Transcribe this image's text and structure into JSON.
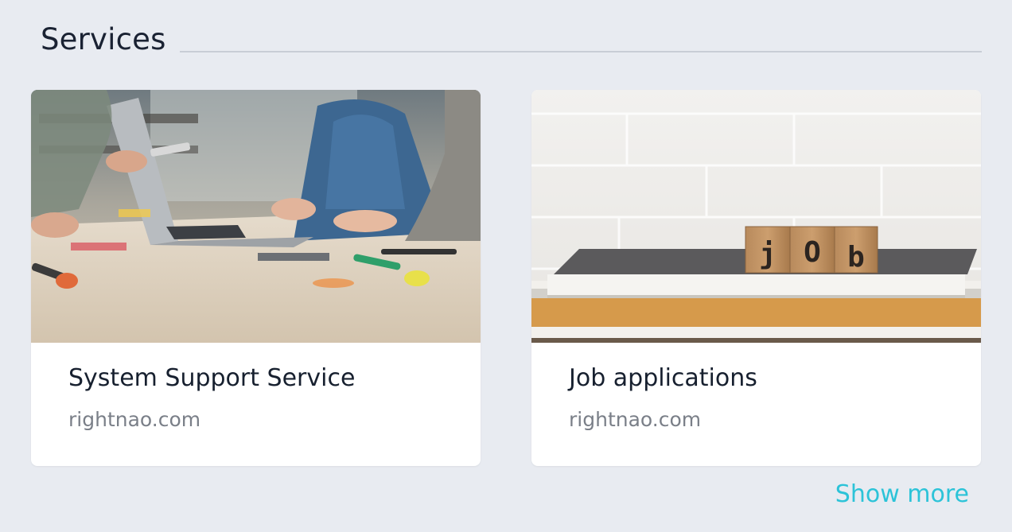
{
  "section": {
    "title": "Services"
  },
  "cards": [
    {
      "title": "System Support Service",
      "source": "rightnao.com",
      "image_description_icon": "office-teamwork-photo"
    },
    {
      "title": "Job applications",
      "source": "rightnao.com",
      "image_description_icon": "job-blocks-photo",
      "blocks": [
        "j",
        "O",
        "b"
      ]
    }
  ],
  "footer": {
    "show_more_label": "Show more"
  },
  "colors": {
    "background": "#e8ebf1",
    "card": "#ffffff",
    "title_text": "#17202f",
    "muted_text": "#7a7f88",
    "accent_link": "#2cc3d8",
    "rule": "#c8cdd6"
  }
}
